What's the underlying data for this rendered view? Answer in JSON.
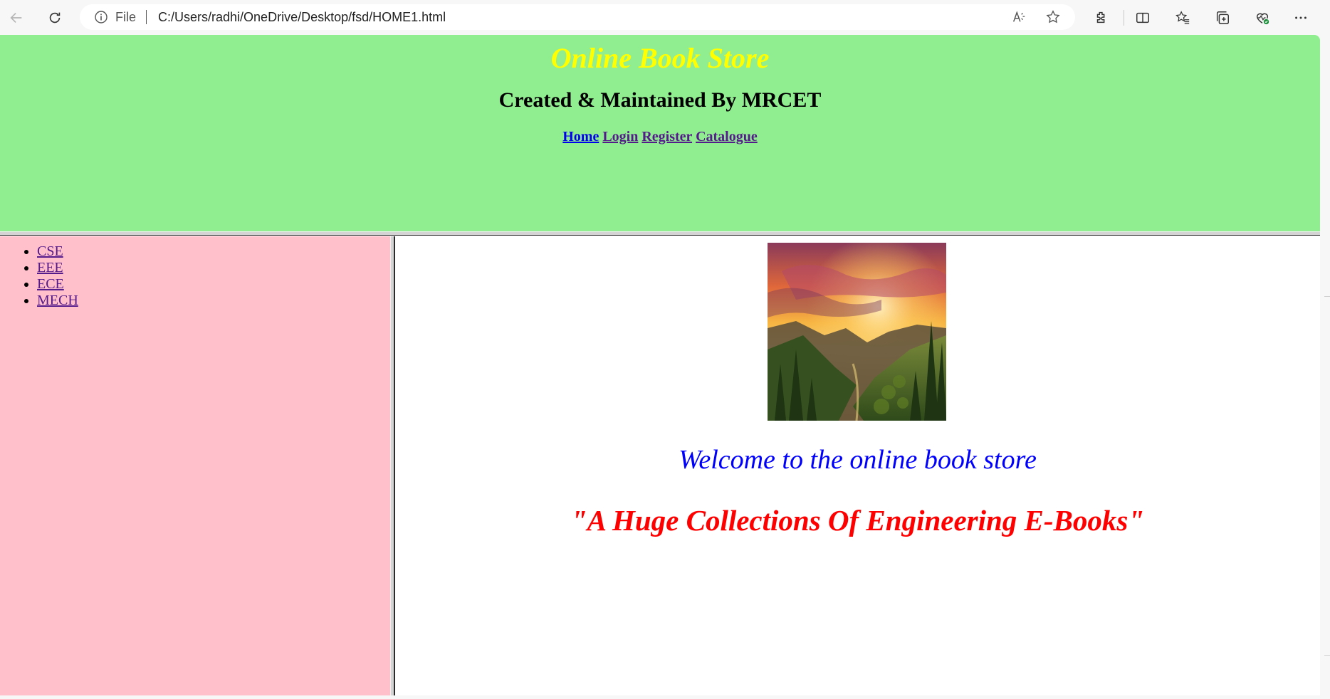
{
  "browser": {
    "file_label": "File",
    "url": "C:/Users/radhi/OneDrive/Desktop/fsd/HOME1.html"
  },
  "header": {
    "title": "Online Book Store",
    "subtitle": "Created & Maintained By MRCET",
    "nav": {
      "home": "Home",
      "login": "Login",
      "register": "Register",
      "catalogue": "Catalogue"
    }
  },
  "sidebar": {
    "items": [
      {
        "label": "CSE"
      },
      {
        "label": "EEE"
      },
      {
        "label": "ECE"
      },
      {
        "label": "MECH"
      }
    ]
  },
  "main": {
    "welcome": "Welcome to the online book store",
    "tagline": "\"A Huge Collections Of Engineering E-Books\""
  },
  "colors": {
    "header_bg": "#90ee90",
    "title": "#ffff00",
    "sidebar_bg": "#ffc0cb",
    "welcome": "#0000ff",
    "tagline": "#ff0000"
  },
  "icons": [
    "back-icon",
    "reload-icon",
    "info-icon",
    "read-aloud-icon",
    "favorite-star-icon",
    "extensions-icon",
    "split-screen-icon",
    "favorites-icon",
    "collections-icon",
    "browser-essentials-icon",
    "more-icon"
  ]
}
